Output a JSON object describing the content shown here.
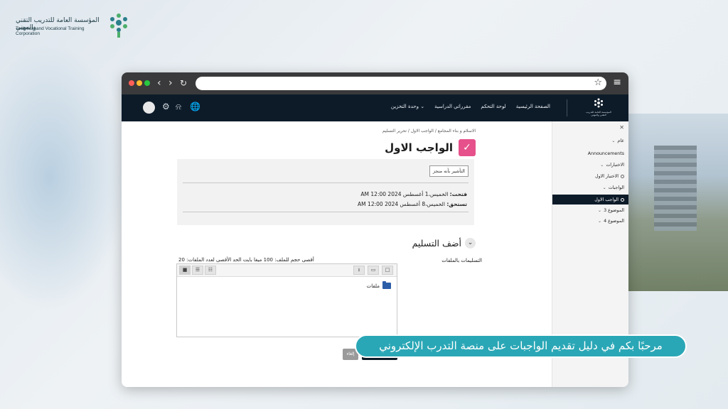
{
  "corporation": {
    "name_ar": "المؤسسة العامة للتدريب التقني والمهني",
    "name_en": "Technical and Vocational Training Corporation"
  },
  "browser": {
    "back_icon": "chevron-left-icon",
    "forward_icon": "chevron-right-icon",
    "reload_icon": "reload-icon",
    "star_icon": "star-icon",
    "menu_icon": "hamburger-icon"
  },
  "header": {
    "nav": [
      "الصفحة الرئيسية",
      "لوحة التحكم",
      "مقرراتي الدراسية",
      "وحدة التخزين"
    ],
    "logo_text": "المؤسسة العامة للتدريب التقني والمهني",
    "icons": [
      "avatar",
      "gear-icon",
      "bell-icon",
      "globe-icon"
    ]
  },
  "main": {
    "breadcrumb": "الاسلام و بناء المجامع / الواجب الاول / تحرير التسليم",
    "title": "الواجب الاول",
    "mark_done": "التأشير بأنه منجز",
    "opened_label": "فتحت:",
    "opened_value": "الخميس،1 أغسطس 2024 12:00 AM",
    "due_label": "تستحق:",
    "due_value": "الخميس،8 أغسطس 2024 12:00 AM",
    "section_title": "أضف التسليم",
    "file_submissions_label": "التسليمات بالملفات",
    "limits": "أقصى حجم للملف: 100 ميغا بايت الحد الأقصى لعدد الملفات: 20",
    "folder_label": "ملفات",
    "cancel_label": "إلغاء"
  },
  "drawer": {
    "items": [
      {
        "label": "عام",
        "type": "section"
      },
      {
        "label": "Announcements",
        "type": "item"
      },
      {
        "label": "الاختبارات",
        "type": "section"
      },
      {
        "label": "الاختبار الاول",
        "type": "activity"
      },
      {
        "label": "الواجبات",
        "type": "section"
      },
      {
        "label": "الواجب الاول",
        "type": "activity-active"
      },
      {
        "label": "الموضوع 3",
        "type": "section"
      },
      {
        "label": "الموضوع 4",
        "type": "section"
      }
    ]
  },
  "caption": "مرحبًا بكم في دليل تقديم الواجبات على منصة التدرب الإلكتروني",
  "colors": {
    "header_bg": "#0d1b29",
    "assign_icon": "#e6518b",
    "caption_bg": "#2aa7b6"
  }
}
